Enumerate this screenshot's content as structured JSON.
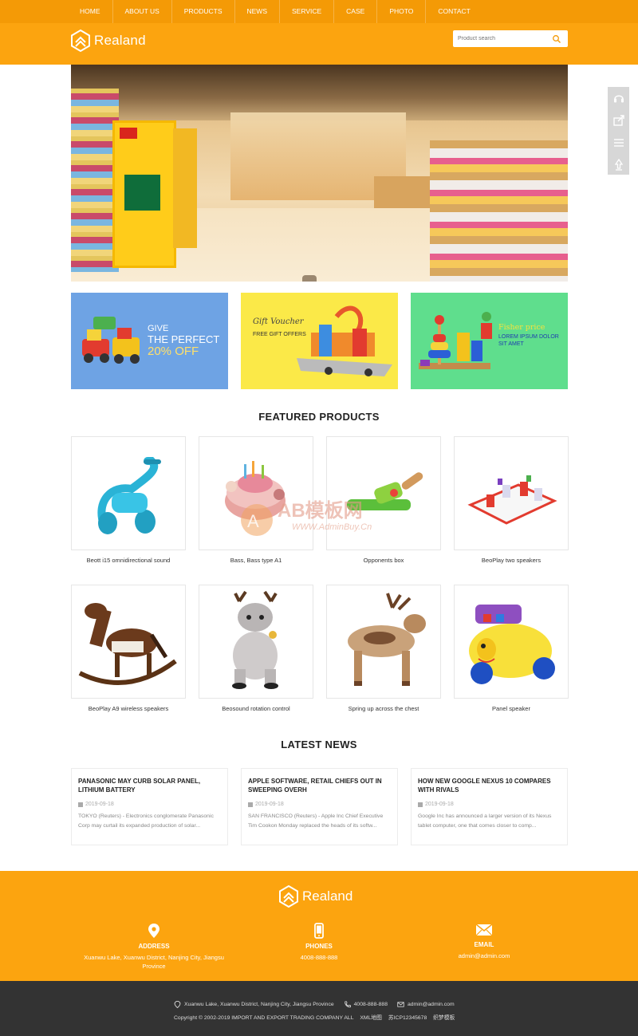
{
  "nav": {
    "items": [
      {
        "label": "HOME"
      },
      {
        "label": "ABOUT US"
      },
      {
        "label": "PRODUCTS"
      },
      {
        "label": "NEWS"
      },
      {
        "label": "SERVICE"
      },
      {
        "label": "CASE"
      },
      {
        "label": "PHOTO"
      },
      {
        "label": "CONTACT"
      }
    ]
  },
  "header": {
    "logo_text": "Realand",
    "search_placeholder": "Product search",
    "search_icon": "search-icon"
  },
  "promos": {
    "p1": {
      "line1": "GIVE",
      "line2": "THE PERFECT",
      "line3": "20% OFF"
    },
    "p2": {
      "line1": "Gift Voucher",
      "line2": "FREE GIFT OFFERS"
    },
    "p3": {
      "line1": "Fisher price",
      "line2": "LOREM IPSUM DOLOR SIT AMET"
    }
  },
  "featured": {
    "title": "FEATURED PRODUCTS",
    "products": [
      {
        "name": "Beott i15 omnidirectional sound"
      },
      {
        "name": "Bass, Bass type A1"
      },
      {
        "name": "Opponents box"
      },
      {
        "name": "BeoPlay two speakers"
      },
      {
        "name": "BeoPlay A9 wireless speakers"
      },
      {
        "name": "Beosound rotation control"
      },
      {
        "name": "Spring up across the chest"
      },
      {
        "name": "Panel speaker"
      }
    ]
  },
  "watermark": {
    "line1": "AB模板网",
    "line2": "WWW.AdminBuy.Cn"
  },
  "latest": {
    "title": "LATEST NEWS",
    "items": [
      {
        "title": "PANASONIC MAY CURB SOLAR PANEL, LITHIUM BATTERY",
        "date": "2019-09-18",
        "summary": "TOKYO (Reuters) - Electronics conglomerate Panasonic Corp may curtail its expanded production of solar..."
      },
      {
        "title": "APPLE SOFTWARE, RETAIL CHIEFS OUT IN SWEEPING OVERH",
        "date": "2019-09-18",
        "summary": "SAN FRANCISCO (Reuters) - Apple Inc Chief Executive Tim Cookon Monday replaced the heads of its softw..."
      },
      {
        "title": "HOW NEW GOOGLE NEXUS 10 COMPARES WITH RIVALS",
        "date": "2019-09-18",
        "summary": "Google Inc has announced a larger version of its Nexus tablet computer, one that comes closer to comp..."
      }
    ]
  },
  "footer": {
    "logo_text": "Realand",
    "address": {
      "label": "ADDRESS",
      "value": "Xuanwu Lake, Xuanwu District, Nanjing City, Jiangsu Province"
    },
    "phone": {
      "label": "PHONES",
      "value": "4008-888-888"
    },
    "email": {
      "label": "EMAIL",
      "value": "admin@admin.com"
    }
  },
  "bottom": {
    "address": "Xuanwu Lake, Xuanwu District, Nanjing City, Jiangsu Province",
    "phone": "4008-888-888",
    "email": "admin@admin.com",
    "copyright": "Copyright © 2002-2019 IMPORT AND EXPORT TRADING COMPANY  ALL",
    "xml": "XML地图",
    "icp": "苏ICP12345678",
    "cms": "织梦模板"
  },
  "colors": {
    "brand": "#fca40f",
    "nav": "#f49a06",
    "dark": "#333333"
  }
}
